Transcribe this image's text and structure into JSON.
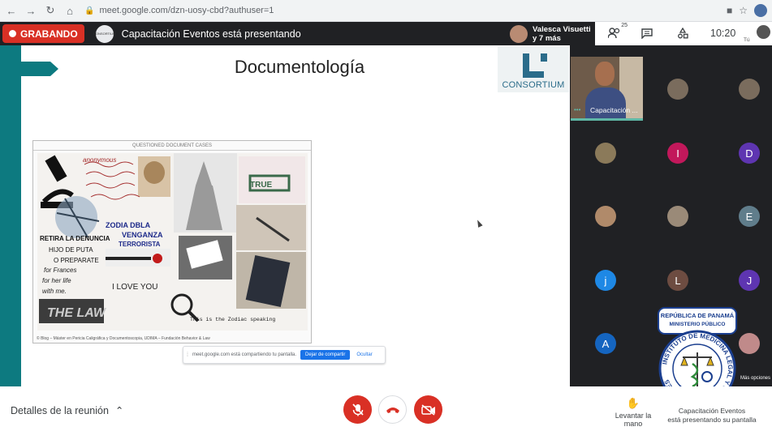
{
  "browser": {
    "url": "meet.google.com/dzn-uosy-cbd?authuser=1",
    "back_icon": "arrow-left-icon",
    "forward_icon": "arrow-right-icon",
    "reload_icon": "reload-icon",
    "home_icon": "home-icon"
  },
  "meet_header": {
    "recording_label": "GRABANDO",
    "presenter_logo_text": "CONSORTIUM",
    "presenting_text": "Capacitación Eventos está presentando",
    "participant_chip_name": "Valesca Visuetti",
    "participant_chip_more": "y 7 más",
    "participants_count": "25",
    "clock": "10:20",
    "self_label": "Tú"
  },
  "slide": {
    "title": "Documentología",
    "logo_text": "CONSORTIUM",
    "collage_header": "QUESTIONED DOCUMENT CASES",
    "collage_credit": "© Blog – Máster en Pericia Caligráfica y Documentoscopia, UDIMA – Fundación Behavior & Law",
    "collage_snippets": [
      "anonymous",
      "TRUE",
      "RETIRA LA DENUNCIA",
      "HIJO DE PUTA",
      "O PREPARATE",
      "ZODIA DBLA",
      "VENGANZA",
      "TERRORISTA",
      "for Frances",
      "for her life",
      "with me.",
      "I LOVE YOU",
      "THE LAW",
      "This is the Zodiac speaking"
    ]
  },
  "share_bar": {
    "text": "meet.google.com está compartiendo tu pantalla.",
    "stop_label": "Dejar de compartir",
    "hide_label": "Ocultar"
  },
  "grid": {
    "main_tile_name": "Capacitación ...",
    "avatars": [
      {
        "letter": "",
        "color": "#7a6c5d"
      },
      {
        "letter": "",
        "color": "#7a6c5d"
      },
      {
        "letter": "",
        "color": "#8b7a5a"
      },
      {
        "letter": "I",
        "color": "#c2185b"
      },
      {
        "letter": "D",
        "color": "#5e35b1"
      },
      {
        "letter": "",
        "color": "#b08a6a"
      },
      {
        "letter": "",
        "color": "#9a8a78"
      },
      {
        "letter": "E",
        "color": "#607d8b"
      },
      {
        "letter": "j",
        "color": "#1e88e5"
      },
      {
        "letter": "L",
        "color": "#6d4c41"
      },
      {
        "letter": "J",
        "color": "#5e35b1"
      },
      {
        "letter": "A",
        "color": "#1565c0"
      },
      {
        "letter": "",
        "color": "#c08a8a"
      }
    ],
    "more_options": "Más opciones"
  },
  "seal": {
    "top_line1": "REPÚBLICA DE PANAMÁ",
    "top_line2": "MINISTERIO PÚBLICO",
    "ring_text": "INSTITUTO DE MEDICINA LEGAL Y CIENCIAS FORENSES"
  },
  "bottom": {
    "details_label": "Detalles de la reunión",
    "mic_icon": "mic-off-icon",
    "hangup_icon": "hangup-icon",
    "camera_icon": "camera-off-icon",
    "raise_hand_label": "Levantar la mano",
    "presenting_note_line1": "Capacitación Eventos",
    "presenting_note_line2": "está presentando su pantalla"
  },
  "colors": {
    "recording": "#d93025",
    "slide_accent": "#0d7a80",
    "meet_dark": "#202124",
    "share_blue": "#1a73e8"
  }
}
